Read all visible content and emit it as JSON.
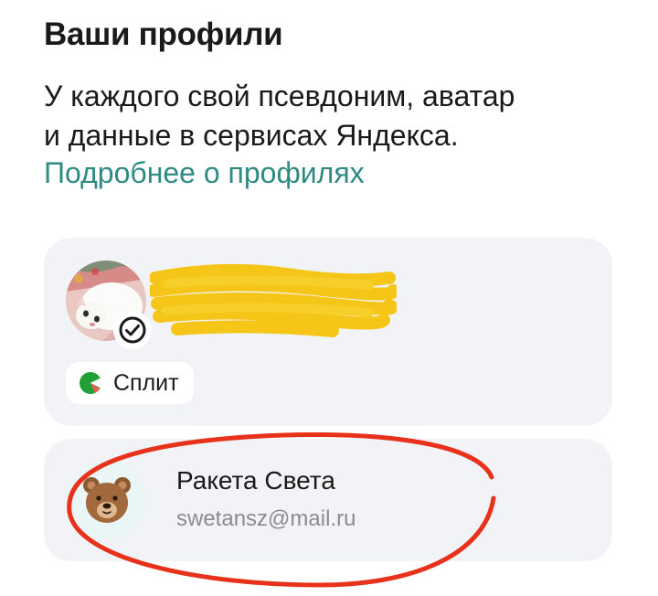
{
  "header": {
    "title": "Ваши профили"
  },
  "description": {
    "line1": "У каждого свой псевдоним, аватар",
    "line2": "и данные в сервисах Яндекса."
  },
  "learn_more_link": "Подробнее о профилях",
  "profiles": [
    {
      "name": "",
      "verified": true,
      "badges": [
        {
          "label": "Сплит",
          "icon": "split-icon"
        }
      ]
    },
    {
      "name": "Ракета Света",
      "email": "swetansz@mail.ru",
      "avatar": "bear-icon"
    }
  ],
  "colors": {
    "link": "#2e8b84",
    "card_background": "#f2f3f6",
    "redaction": "#f5c518",
    "annotation": "#e8311a",
    "split_green": "#21a038"
  }
}
